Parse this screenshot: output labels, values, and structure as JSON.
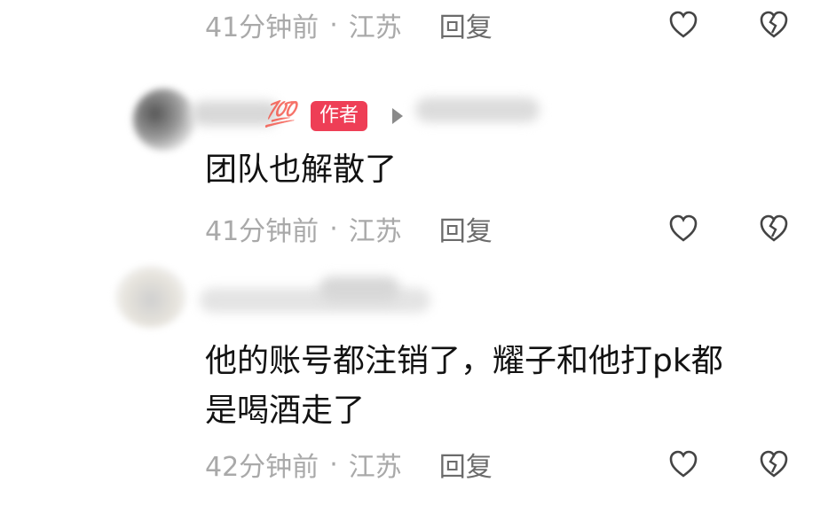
{
  "comments": [
    {
      "meta": {
        "time": "41分钟前",
        "location": "江苏",
        "reply": "回复"
      }
    },
    {
      "name_fragment": "哥",
      "badge_emoji": "💯",
      "badge": "作者",
      "target_name_fragment": "王",
      "text": "团队也解散了",
      "meta": {
        "time": "41分钟前",
        "location": "江苏",
        "reply": "回复"
      }
    },
    {
      "text_line1": "他的账号都注销了，耀子和他打pk都",
      "text_line2": "是喝酒走了",
      "meta": {
        "time": "42分钟前",
        "location": "江苏",
        "reply": "回复"
      }
    }
  ],
  "icons": {
    "like": "heart-outline-icon",
    "dislike": "broken-heart-icon"
  },
  "colors": {
    "badge": "#ee3e56",
    "meta": "#a9a9a9",
    "text": "#121212"
  }
}
